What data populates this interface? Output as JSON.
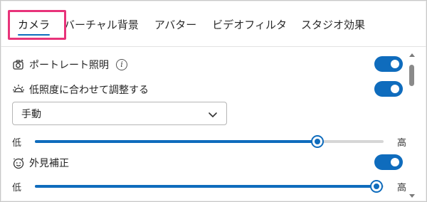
{
  "tabs": [
    {
      "label": "カメラ",
      "active": true
    },
    {
      "label": "バーチャル背景",
      "active": false
    },
    {
      "label": "アバター",
      "active": false
    },
    {
      "label": "ビデオフィルタ",
      "active": false
    },
    {
      "label": "スタジオ効果",
      "active": false
    }
  ],
  "settings": {
    "portrait_lighting": {
      "label": "ポートレート照明",
      "icon": "camera-light-icon",
      "info_icon": "info-icon",
      "info_glyph": "i",
      "enabled": true
    },
    "low_light": {
      "label": "低照度に合わせて調整する",
      "icon": "brightness-icon",
      "enabled": true
    },
    "mode_select": {
      "value": "手動"
    },
    "slider1": {
      "low_label": "低",
      "high_label": "高",
      "value_fraction": 0.81
    },
    "appearance": {
      "label": "外見補正",
      "icon": "face-smile-icon",
      "enabled": true
    },
    "slider2": {
      "low_label": "低",
      "high_label": "高",
      "value_fraction": 0.98
    }
  },
  "colors": {
    "accent": "#0f6cbd",
    "highlight": "#e8337a"
  }
}
